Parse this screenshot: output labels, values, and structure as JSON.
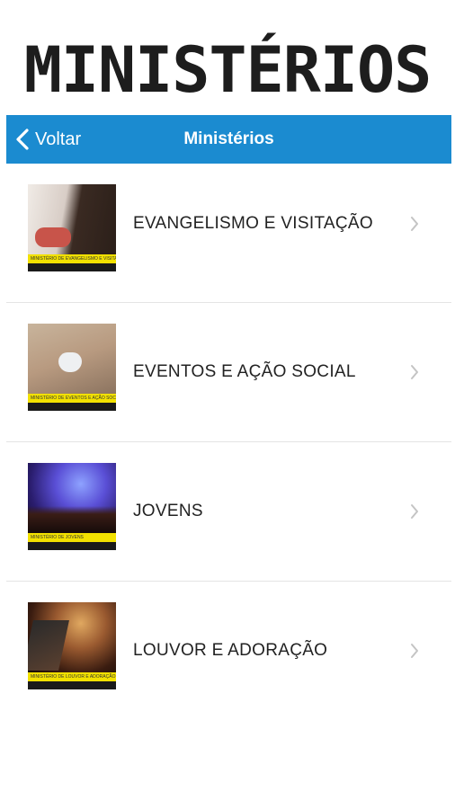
{
  "promo": {
    "title": "MINISTÉRIOS"
  },
  "navbar": {
    "back_label": "Voltar",
    "title": "Ministérios",
    "color": "#1b8bd0"
  },
  "list": {
    "items": [
      {
        "label": "EVANGELISMO E VISITAÇÃO",
        "thumb_caption": "Ministério de Evangelismo e Visitação"
      },
      {
        "label": "EVENTOS E AÇÃO SOCIAL",
        "thumb_caption": "Ministério de Eventos e Ação Social"
      },
      {
        "label": "JOVENS",
        "thumb_caption": "Ministério de Jovens"
      },
      {
        "label": "LOUVOR E ADORAÇÃO",
        "thumb_caption": "Ministério de Louvor e Adoração"
      }
    ]
  }
}
